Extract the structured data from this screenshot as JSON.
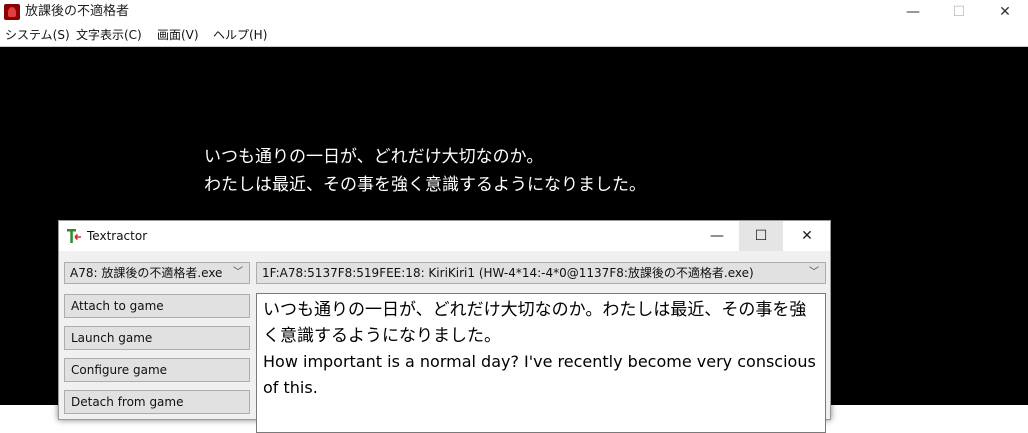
{
  "game": {
    "title": "放課後の不適格者",
    "menu": [
      "システム(S)",
      "文字表示(C)",
      "画面(V)",
      "ヘルプ(H)"
    ],
    "controls": {
      "minimize": "—",
      "maximize": "☐",
      "close": "✕"
    },
    "text_lines": [
      "いつも通りの一日が、どれだけ大切なのか。",
      "わたしは最近、その事を強く意識するようになりました。"
    ]
  },
  "textractor": {
    "title": "Textractor",
    "controls": {
      "minimize": "—",
      "maximize": "☐",
      "close": "✕"
    },
    "process_select": "A78: 放課後の不適格者.exe",
    "hook_select": "1F:A78:5137F8:519FEE:18: KiriKiri1 (HW-4*14:-4*0@1137F8:放課後の不適格者.exe)",
    "buttons": {
      "attach": "Attach to game",
      "launch": "Launch game",
      "configure": "Configure game",
      "detach": "Detach from game"
    },
    "output": {
      "japanese": "いつも通りの一日が、どれだけ大切なのか。わたしは最近、その事を強く意識するようになりました。",
      "english": "How important is a normal day? I've recently become very conscious of this."
    },
    "icon": "textractor-logo-icon",
    "accent_colors": {
      "icon_green": "#2e8b2e",
      "icon_red": "#d03030"
    }
  }
}
